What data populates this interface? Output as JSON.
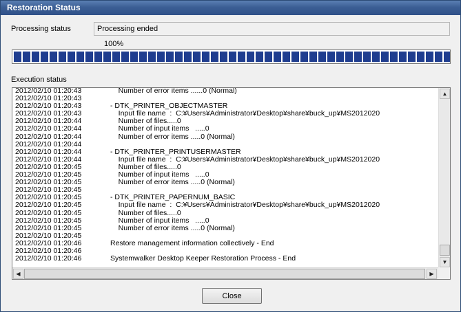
{
  "window": {
    "title": "Restoration Status"
  },
  "processing": {
    "label": "Processing status",
    "value": "Processing ended"
  },
  "progress": {
    "label": "100%",
    "percent": 100,
    "segments": 49
  },
  "execution": {
    "label": "Execution status",
    "lines": [
      {
        "ts": "2012/02/10 01:20:43",
        "msg": "    Number of error items ......0 (Normal)"
      },
      {
        "ts": "2012/02/10 01:20:43",
        "msg": ""
      },
      {
        "ts": "2012/02/10 01:20:43",
        "msg": "- DTK_PRINTER_OBJECTMASTER"
      },
      {
        "ts": "2012/02/10 01:20:43",
        "msg": "    Input file name  :  C:¥Users¥Administrator¥Desktop¥share¥buck_up¥MS2012020"
      },
      {
        "ts": "2012/02/10 01:20:44",
        "msg": "    Number of files.....0"
      },
      {
        "ts": "2012/02/10 01:20:44",
        "msg": "    Number of input items   .....0"
      },
      {
        "ts": "2012/02/10 01:20:44",
        "msg": "    Number of error items .....0 (Normal)"
      },
      {
        "ts": "2012/02/10 01:20:44",
        "msg": ""
      },
      {
        "ts": "2012/02/10 01:20:44",
        "msg": "- DTK_PRINTER_PRINTUSERMASTER"
      },
      {
        "ts": "2012/02/10 01:20:44",
        "msg": "    Input file name  :  C:¥Users¥Administrator¥Desktop¥share¥buck_up¥MS2012020"
      },
      {
        "ts": "2012/02/10 01:20:45",
        "msg": "    Number of files.....0"
      },
      {
        "ts": "2012/02/10 01:20:45",
        "msg": "    Number of input items   .....0"
      },
      {
        "ts": "2012/02/10 01:20:45",
        "msg": "    Number of error items .....0 (Normal)"
      },
      {
        "ts": "2012/02/10 01:20:45",
        "msg": ""
      },
      {
        "ts": "2012/02/10 01:20:45",
        "msg": "- DTK_PRINTER_PAPERNUM_BASIC"
      },
      {
        "ts": "2012/02/10 01:20:45",
        "msg": "    Input file name  :  C:¥Users¥Administrator¥Desktop¥share¥buck_up¥MS2012020"
      },
      {
        "ts": "2012/02/10 01:20:45",
        "msg": "    Number of files.....0"
      },
      {
        "ts": "2012/02/10 01:20:45",
        "msg": "    Number of input items   .....0"
      },
      {
        "ts": "2012/02/10 01:20:45",
        "msg": "    Number of error items .....0 (Normal)"
      },
      {
        "ts": "2012/02/10 01:20:45",
        "msg": ""
      },
      {
        "ts": "2012/02/10 01:20:46",
        "msg": "Restore management information collectively - End"
      },
      {
        "ts": "2012/02/10 01:20:46",
        "msg": ""
      },
      {
        "ts": "2012/02/10 01:20:46",
        "msg": "Systemwalker Desktop Keeper Restoration Process - End"
      }
    ]
  },
  "buttons": {
    "close": "Close"
  },
  "icons": {
    "scroll_up": "arrow-up-icon",
    "scroll_down": "arrow-down-icon",
    "scroll_left": "arrow-left-icon",
    "scroll_right": "arrow-right-icon"
  },
  "colors": {
    "titlebar": "#3c5f95",
    "progress_fill": "#1f3d8f"
  }
}
